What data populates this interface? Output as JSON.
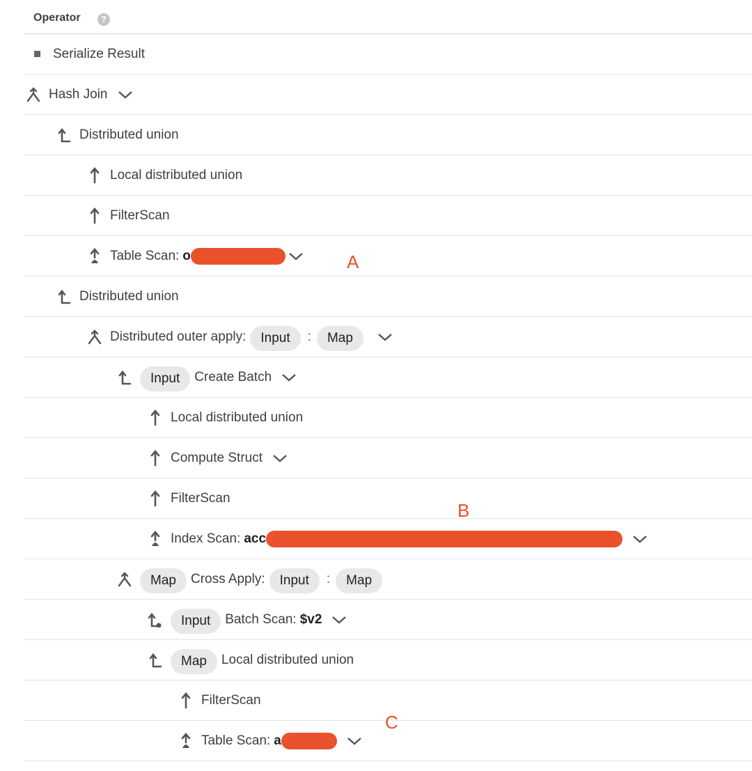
{
  "header": {
    "label": "Operator",
    "help_glyph": "?"
  },
  "rows": [
    {
      "label": "Serialize Result",
      "icon": "square-bullet-icon"
    },
    {
      "label": "Hash Join",
      "icon": "join-icon"
    },
    {
      "label": "Distributed union",
      "icon": "union-icon"
    },
    {
      "label": "Local distributed union",
      "icon": "arrow-up-icon"
    },
    {
      "label": "FilterScan",
      "icon": "arrow-up-icon"
    },
    {
      "label": "Table Scan:",
      "bold": "o",
      "icon": "scan-icon"
    },
    {
      "label": "Distributed union",
      "icon": "union-icon"
    },
    {
      "label": "Distributed outer apply:",
      "chip1": "Input",
      "sep": ":",
      "chip2": "Map",
      "icon": "join-icon"
    },
    {
      "chip": "Input",
      "label": "Create Batch",
      "icon": "union-icon"
    },
    {
      "label": "Local distributed union",
      "icon": "arrow-up-icon"
    },
    {
      "label": "Compute Struct",
      "icon": "arrow-up-icon"
    },
    {
      "label": "FilterScan",
      "icon": "arrow-up-icon"
    },
    {
      "label": "Index Scan:",
      "bold": "acc",
      "icon": "scan-icon"
    },
    {
      "chip": "Map",
      "label": "Cross Apply:",
      "chip1": "Input",
      "sep": ":",
      "chip2": "Map",
      "icon": "join-icon"
    },
    {
      "chip": "Input",
      "label": "Batch Scan:",
      "bold": "$v2",
      "icon": "batch-union-icon"
    },
    {
      "chip": "Map",
      "label": "Local distributed union",
      "icon": "union-icon"
    },
    {
      "label": "FilterScan",
      "icon": "arrow-up-icon"
    },
    {
      "label": "Table Scan:",
      "bold": "a",
      "icon": "scan-icon"
    }
  ],
  "annotations": {
    "a": "A",
    "b": "B",
    "c": "C"
  },
  "colors": {
    "redaction": "#e9522c",
    "annotation": "#e9522c",
    "chip_bg": "#e8e8e8",
    "divider": "#e3e3e3"
  }
}
